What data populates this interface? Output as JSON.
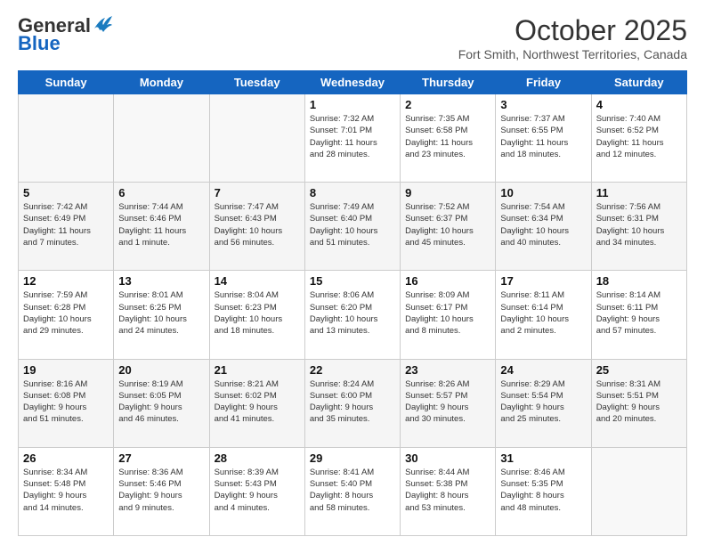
{
  "header": {
    "logo_general": "General",
    "logo_blue": "Blue",
    "month": "October 2025",
    "location": "Fort Smith, Northwest Territories, Canada"
  },
  "weekdays": [
    "Sunday",
    "Monday",
    "Tuesday",
    "Wednesday",
    "Thursday",
    "Friday",
    "Saturday"
  ],
  "weeks": [
    [
      {
        "day": "",
        "info": ""
      },
      {
        "day": "",
        "info": ""
      },
      {
        "day": "",
        "info": ""
      },
      {
        "day": "1",
        "info": "Sunrise: 7:32 AM\nSunset: 7:01 PM\nDaylight: 11 hours\nand 28 minutes."
      },
      {
        "day": "2",
        "info": "Sunrise: 7:35 AM\nSunset: 6:58 PM\nDaylight: 11 hours\nand 23 minutes."
      },
      {
        "day": "3",
        "info": "Sunrise: 7:37 AM\nSunset: 6:55 PM\nDaylight: 11 hours\nand 18 minutes."
      },
      {
        "day": "4",
        "info": "Sunrise: 7:40 AM\nSunset: 6:52 PM\nDaylight: 11 hours\nand 12 minutes."
      }
    ],
    [
      {
        "day": "5",
        "info": "Sunrise: 7:42 AM\nSunset: 6:49 PM\nDaylight: 11 hours\nand 7 minutes."
      },
      {
        "day": "6",
        "info": "Sunrise: 7:44 AM\nSunset: 6:46 PM\nDaylight: 11 hours\nand 1 minute."
      },
      {
        "day": "7",
        "info": "Sunrise: 7:47 AM\nSunset: 6:43 PM\nDaylight: 10 hours\nand 56 minutes."
      },
      {
        "day": "8",
        "info": "Sunrise: 7:49 AM\nSunset: 6:40 PM\nDaylight: 10 hours\nand 51 minutes."
      },
      {
        "day": "9",
        "info": "Sunrise: 7:52 AM\nSunset: 6:37 PM\nDaylight: 10 hours\nand 45 minutes."
      },
      {
        "day": "10",
        "info": "Sunrise: 7:54 AM\nSunset: 6:34 PM\nDaylight: 10 hours\nand 40 minutes."
      },
      {
        "day": "11",
        "info": "Sunrise: 7:56 AM\nSunset: 6:31 PM\nDaylight: 10 hours\nand 34 minutes."
      }
    ],
    [
      {
        "day": "12",
        "info": "Sunrise: 7:59 AM\nSunset: 6:28 PM\nDaylight: 10 hours\nand 29 minutes."
      },
      {
        "day": "13",
        "info": "Sunrise: 8:01 AM\nSunset: 6:25 PM\nDaylight: 10 hours\nand 24 minutes."
      },
      {
        "day": "14",
        "info": "Sunrise: 8:04 AM\nSunset: 6:23 PM\nDaylight: 10 hours\nand 18 minutes."
      },
      {
        "day": "15",
        "info": "Sunrise: 8:06 AM\nSunset: 6:20 PM\nDaylight: 10 hours\nand 13 minutes."
      },
      {
        "day": "16",
        "info": "Sunrise: 8:09 AM\nSunset: 6:17 PM\nDaylight: 10 hours\nand 8 minutes."
      },
      {
        "day": "17",
        "info": "Sunrise: 8:11 AM\nSunset: 6:14 PM\nDaylight: 10 hours\nand 2 minutes."
      },
      {
        "day": "18",
        "info": "Sunrise: 8:14 AM\nSunset: 6:11 PM\nDaylight: 9 hours\nand 57 minutes."
      }
    ],
    [
      {
        "day": "19",
        "info": "Sunrise: 8:16 AM\nSunset: 6:08 PM\nDaylight: 9 hours\nand 51 minutes."
      },
      {
        "day": "20",
        "info": "Sunrise: 8:19 AM\nSunset: 6:05 PM\nDaylight: 9 hours\nand 46 minutes."
      },
      {
        "day": "21",
        "info": "Sunrise: 8:21 AM\nSunset: 6:02 PM\nDaylight: 9 hours\nand 41 minutes."
      },
      {
        "day": "22",
        "info": "Sunrise: 8:24 AM\nSunset: 6:00 PM\nDaylight: 9 hours\nand 35 minutes."
      },
      {
        "day": "23",
        "info": "Sunrise: 8:26 AM\nSunset: 5:57 PM\nDaylight: 9 hours\nand 30 minutes."
      },
      {
        "day": "24",
        "info": "Sunrise: 8:29 AM\nSunset: 5:54 PM\nDaylight: 9 hours\nand 25 minutes."
      },
      {
        "day": "25",
        "info": "Sunrise: 8:31 AM\nSunset: 5:51 PM\nDaylight: 9 hours\nand 20 minutes."
      }
    ],
    [
      {
        "day": "26",
        "info": "Sunrise: 8:34 AM\nSunset: 5:48 PM\nDaylight: 9 hours\nand 14 minutes."
      },
      {
        "day": "27",
        "info": "Sunrise: 8:36 AM\nSunset: 5:46 PM\nDaylight: 9 hours\nand 9 minutes."
      },
      {
        "day": "28",
        "info": "Sunrise: 8:39 AM\nSunset: 5:43 PM\nDaylight: 9 hours\nand 4 minutes."
      },
      {
        "day": "29",
        "info": "Sunrise: 8:41 AM\nSunset: 5:40 PM\nDaylight: 8 hours\nand 58 minutes."
      },
      {
        "day": "30",
        "info": "Sunrise: 8:44 AM\nSunset: 5:38 PM\nDaylight: 8 hours\nand 53 minutes."
      },
      {
        "day": "31",
        "info": "Sunrise: 8:46 AM\nSunset: 5:35 PM\nDaylight: 8 hours\nand 48 minutes."
      },
      {
        "day": "",
        "info": ""
      }
    ]
  ]
}
